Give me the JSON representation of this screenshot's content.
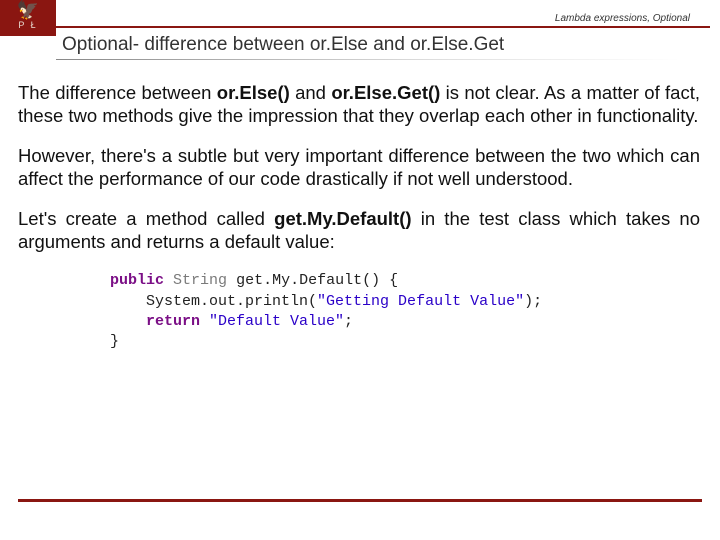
{
  "breadcrumb": "Lambda expressions, Optional",
  "logo": {
    "eagle": "🦅",
    "letters": "P   Ł"
  },
  "title": "Optional- difference between or.Else and or.Else.Get",
  "para1": {
    "t1": "The difference between ",
    "b1": "or.Else()",
    "t2": " and ",
    "b2": "or.Else.Get()",
    "t3": " is not clear. As a matter of fact, these two methods give the impression that they overlap each other in functionality."
  },
  "para2": "However, there's a subtle but very important difference between the two which can affect the performance of our code drastically if not well understood.",
  "para3": {
    "t1": "Let's create a method called ",
    "b1": "get.My.Default()",
    "t2": " in the test class which takes no arguments and returns a default value:"
  },
  "code": {
    "kw_public": "public",
    "type_string": "String",
    "method_name": "get.My.Default()",
    "brace_open": " {",
    "println_call": "    System.out.println(",
    "str1": "\"Getting Default Value\"",
    "println_end": ");",
    "kw_return": "    return",
    "str2": " \"Default Value\"",
    "ret_end": ";",
    "brace_close": "}"
  }
}
